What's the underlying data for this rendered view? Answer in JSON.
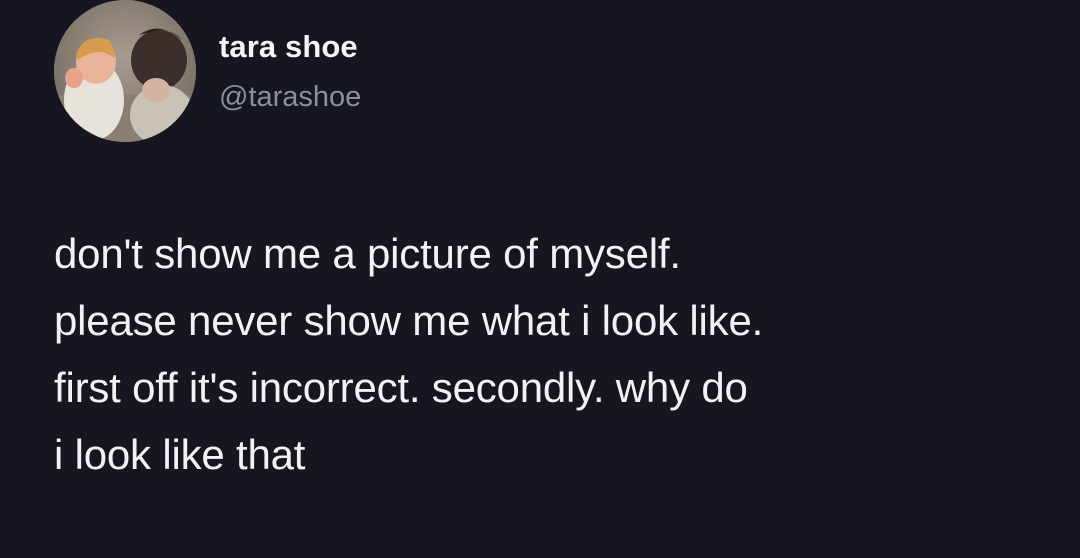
{
  "profile": {
    "display_name": "tara shoe",
    "handle": "@tarashoe",
    "avatar_icon": "profile-photo-avatar"
  },
  "tweet": {
    "lines": [
      "don't show me a picture of myself.",
      "please never show me what i look like.",
      "first off it's incorrect. secondly. why do",
      "i look like that"
    ]
  },
  "colors": {
    "background": "#15161f",
    "text": "#f2f2f4",
    "handle": "#8d9098"
  }
}
